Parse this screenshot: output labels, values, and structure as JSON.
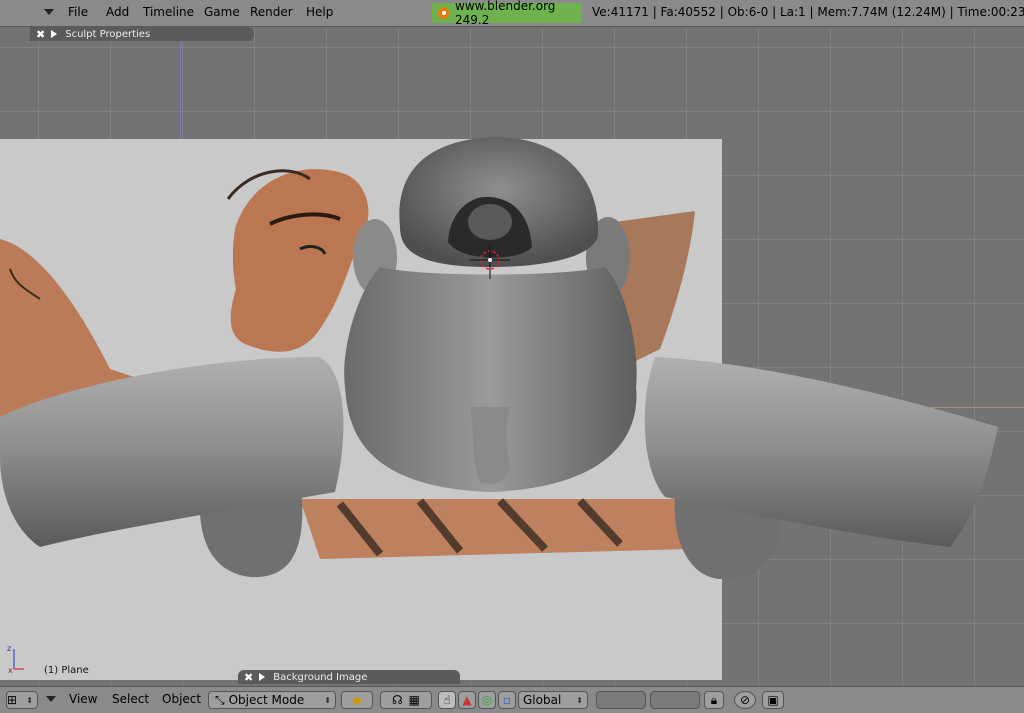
{
  "top_menu": {
    "items": [
      "File",
      "Add",
      "Timeline",
      "Game",
      "Render",
      "Help"
    ],
    "blender_link": "www.blender.org 249.2",
    "stats": "Ve:41171 | Fa:40552 | Ob:6-0 | La:1  | Mem:7.74M (12.24M)  | Time:00:23.4"
  },
  "viewport": {
    "sculpt_panel_title": "Sculpt Properties",
    "background_panel_title": "Background Image",
    "object_label": "(1) Plane",
    "axes": {
      "x": "x",
      "z": "z"
    }
  },
  "bottom_bar": {
    "menus": [
      "View",
      "Select",
      "Object"
    ],
    "mode": "Object Mode",
    "orientation": "Global"
  },
  "colors": {
    "accent_green": "#6fb24d",
    "header_gray": "#8a8a8a",
    "viewport_gray": "#737373"
  }
}
